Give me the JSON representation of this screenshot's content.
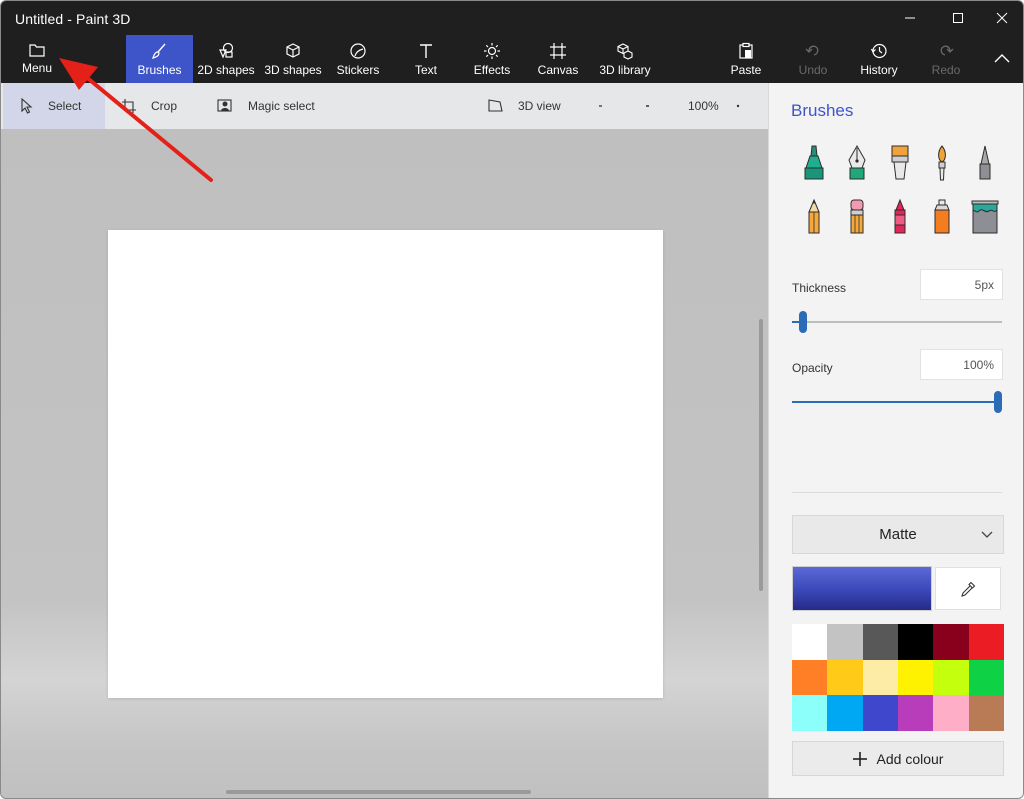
{
  "window": {
    "title": "Untitled - Paint 3D"
  },
  "ribbon": {
    "menu": "Menu",
    "brushes": "Brushes",
    "shapes2d": "2D shapes",
    "shapes3d": "3D shapes",
    "stickers": "Stickers",
    "text": "Text",
    "effects": "Effects",
    "canvas": "Canvas",
    "library": "3D library",
    "paste": "Paste",
    "undo": "Undo",
    "history": "History",
    "redo": "Redo",
    "active_tab": "Brushes"
  },
  "subbar": {
    "select": "Select",
    "crop": "Crop",
    "magic_select": "Magic select",
    "view3d": "3D view",
    "zoom": "100%"
  },
  "panel": {
    "title": "Brushes",
    "tools": [
      "marker-icon",
      "calligraphy-pen-icon",
      "oil-brush-icon",
      "watercolor-icon",
      "pixel-pen-icon",
      "pencil-icon",
      "eraser-icon",
      "crayon-icon",
      "spray-can-icon",
      "fill-icon"
    ],
    "thickness_label": "Thickness",
    "thickness_value": "5px",
    "thickness_level": 0.05,
    "opacity_label": "Opacity",
    "opacity_value": "100%",
    "opacity_level": 1.0,
    "finish": "Matte",
    "current_colour": "#3e46bd",
    "add_colour": "Add colour",
    "palette": [
      "#ffffff",
      "#c3c3c3",
      "#585858",
      "#000000",
      "#88001b",
      "#ec1c24",
      "#ff7f27",
      "#ffca18",
      "#fdeca6",
      "#fff200",
      "#c4ff0e",
      "#0ed145",
      "#8cfffb",
      "#00a8f3",
      "#3f48cc",
      "#b83dba",
      "#ffaec8",
      "#b97a56"
    ]
  },
  "colors": {
    "accent": "#3e55c9",
    "titlebar": "#1f1f1f",
    "annotation_arrow": "#e32119"
  }
}
